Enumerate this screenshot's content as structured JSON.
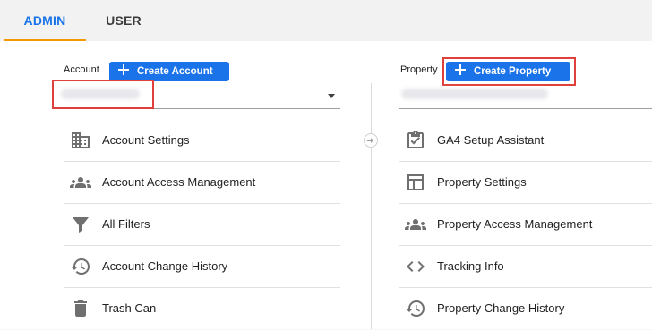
{
  "tabs": [
    {
      "label": "ADMIN",
      "active": true
    },
    {
      "label": "USER",
      "active": false
    }
  ],
  "account": {
    "label": "Account",
    "create_button": "Create Account",
    "selected_value": "",
    "items": [
      {
        "label": "Account Settings",
        "icon": "building-icon"
      },
      {
        "label": "Account Access Management",
        "icon": "people-icon"
      },
      {
        "label": "All Filters",
        "icon": "filter-icon"
      },
      {
        "label": "Account Change History",
        "icon": "history-icon"
      },
      {
        "label": "Trash Can",
        "icon": "trash-icon"
      }
    ]
  },
  "property": {
    "label": "Property",
    "create_button": "Create Property",
    "selected_value": "",
    "items": [
      {
        "label": "GA4 Setup Assistant",
        "icon": "clipboard-check-icon"
      },
      {
        "label": "Property Settings",
        "icon": "layout-icon"
      },
      {
        "label": "Property Access Management",
        "icon": "people-icon"
      },
      {
        "label": "Tracking Info",
        "icon": "code-icon"
      },
      {
        "label": "Property Change History",
        "icon": "history-icon"
      }
    ]
  },
  "colors": {
    "accent": "#1a73e8",
    "tab_indicator": "#f29900",
    "highlight": "#e0403b",
    "icon": "#6f6f6f"
  }
}
